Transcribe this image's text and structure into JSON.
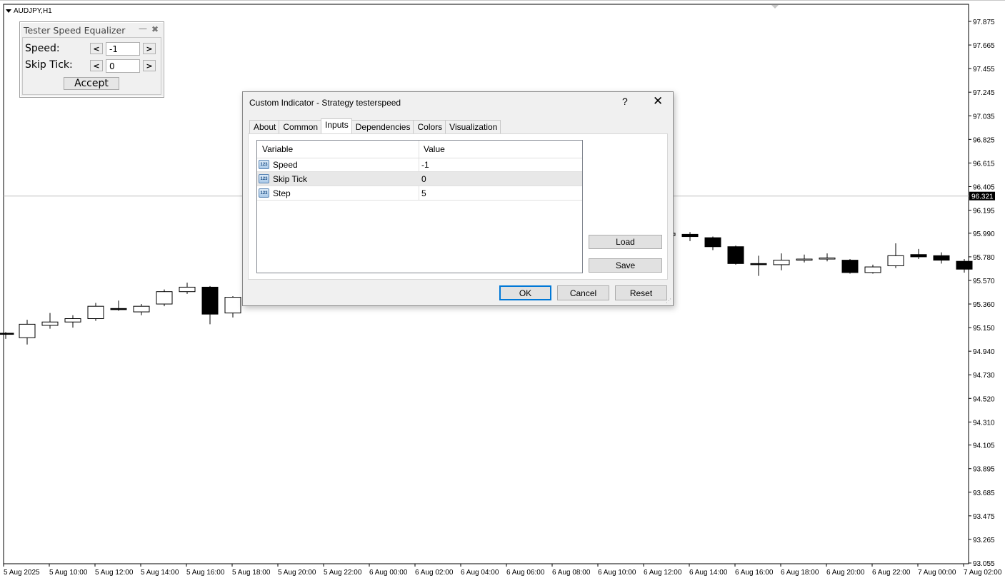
{
  "chart": {
    "symbol": "AUDJPY,H1",
    "y_ticks": [
      "97.875",
      "97.665",
      "97.455",
      "97.245",
      "97.035",
      "96.825",
      "96.615",
      "96.405",
      "96.195",
      "95.990",
      "95.780",
      "95.570",
      "95.360",
      "95.150",
      "94.940",
      "94.730",
      "94.520",
      "94.310",
      "94.105",
      "93.895",
      "93.685",
      "93.475",
      "93.265",
      "93.055"
    ],
    "current_price": "96.321",
    "x_ticks": [
      "5 Aug 2025",
      "5 Aug 10:00",
      "5 Aug 12:00",
      "5 Aug 14:00",
      "5 Aug 16:00",
      "5 Aug 18:00",
      "5 Aug 20:00",
      "5 Aug 22:00",
      "6 Aug 00:00",
      "6 Aug 02:00",
      "6 Aug 04:00",
      "6 Aug 06:00",
      "6 Aug 08:00",
      "6 Aug 10:00",
      "6 Aug 12:00",
      "6 Aug 14:00",
      "6 Aug 16:00",
      "6 Aug 18:00",
      "6 Aug 20:00",
      "6 Aug 22:00",
      "7 Aug 00:00",
      "7 Aug 02:00"
    ]
  },
  "chart_data": {
    "type": "candlestick",
    "ylim": [
      93.055,
      97.875
    ],
    "current_price": 96.321,
    "candles": [
      {
        "t": "5 Aug 08:00",
        "o": 95.1,
        "h": 95.11,
        "l": 95.05,
        "c": 95.09
      },
      {
        "t": "5 Aug 09:00",
        "o": 95.06,
        "h": 95.22,
        "l": 95.0,
        "c": 95.18
      },
      {
        "t": "5 Aug 10:00",
        "o": 95.17,
        "h": 95.28,
        "l": 95.14,
        "c": 95.2
      },
      {
        "t": "5 Aug 10:00",
        "o": 95.2,
        "h": 95.26,
        "l": 95.15,
        "c": 95.23
      },
      {
        "t": "5 Aug 12:00",
        "o": 95.23,
        "h": 95.37,
        "l": 95.21,
        "c": 95.34
      },
      {
        "t": "5 Aug 12:00",
        "o": 95.32,
        "h": 95.39,
        "l": 95.3,
        "c": 95.31
      },
      {
        "t": "5 Aug 14:00",
        "o": 95.29,
        "h": 95.36,
        "l": 95.26,
        "c": 95.34
      },
      {
        "t": "5 Aug 14:00",
        "o": 95.36,
        "h": 95.49,
        "l": 95.34,
        "c": 95.47
      },
      {
        "t": "5 Aug 16:00",
        "o": 95.47,
        "h": 95.55,
        "l": 95.45,
        "c": 95.51
      },
      {
        "t": "5 Aug 16:00",
        "o": 95.51,
        "h": 95.52,
        "l": 95.18,
        "c": 95.27
      },
      {
        "t": "5 Aug 18:00",
        "o": 95.28,
        "h": 95.43,
        "l": 95.24,
        "c": 95.42
      },
      {
        "t": "6 Aug 12:00",
        "o": 95.97,
        "h": 96.0,
        "l": 95.95,
        "c": 95.99
      },
      {
        "t": "6 Aug 13:00",
        "o": 95.98,
        "h": 96.0,
        "l": 95.92,
        "c": 95.96
      },
      {
        "t": "6 Aug 14:00",
        "o": 95.95,
        "h": 95.96,
        "l": 95.84,
        "c": 95.87
      },
      {
        "t": "6 Aug 15:00",
        "o": 95.87,
        "h": 95.88,
        "l": 95.71,
        "c": 95.72
      },
      {
        "t": "6 Aug 16:00",
        "o": 95.72,
        "h": 95.79,
        "l": 95.61,
        "c": 95.71
      },
      {
        "t": "6 Aug 17:00",
        "o": 95.71,
        "h": 95.81,
        "l": 95.66,
        "c": 95.75
      },
      {
        "t": "6 Aug 18:00",
        "o": 95.75,
        "h": 95.8,
        "l": 95.73,
        "c": 95.76
      },
      {
        "t": "6 Aug 19:00",
        "o": 95.76,
        "h": 95.81,
        "l": 95.74,
        "c": 95.77
      },
      {
        "t": "6 Aug 20:00",
        "o": 95.75,
        "h": 95.76,
        "l": 95.63,
        "c": 95.64
      },
      {
        "t": "6 Aug 21:00",
        "o": 95.64,
        "h": 95.71,
        "l": 95.63,
        "c": 95.69
      },
      {
        "t": "6 Aug 22:00",
        "o": 95.7,
        "h": 95.9,
        "l": 95.68,
        "c": 95.79
      },
      {
        "t": "6 Aug 23:00",
        "o": 95.8,
        "h": 95.85,
        "l": 95.76,
        "c": 95.78
      },
      {
        "t": "7 Aug 00:00",
        "o": 95.79,
        "h": 95.82,
        "l": 95.72,
        "c": 95.75
      },
      {
        "t": "7 Aug 01:00",
        "o": 95.74,
        "h": 95.76,
        "l": 95.64,
        "c": 95.67
      }
    ]
  },
  "tester_panel": {
    "title": "Tester Speed Equalizer",
    "min_glyph": "—",
    "close_glyph": "✖",
    "speed_label": "Speed:",
    "speed_value": "-1",
    "skip_label": "Skip Tick:",
    "skip_value": "0",
    "dec_label": "<",
    "inc_label": ">",
    "accept_label": "Accept"
  },
  "dialog": {
    "title": "Custom Indicator - Strategy testerspeed",
    "help": "?",
    "close": "✕",
    "tabs": [
      "About",
      "Common",
      "Inputs",
      "Dependencies",
      "Colors",
      "Visualization"
    ],
    "active_tab": "Inputs",
    "columns": [
      "Variable",
      "Value"
    ],
    "rows": [
      {
        "name": "Speed",
        "value": "-1",
        "icon": "123"
      },
      {
        "name": "Skip Tick",
        "value": "0",
        "icon": "123"
      },
      {
        "name": "Step",
        "value": "5",
        "icon": "123"
      }
    ],
    "load_label": "Load",
    "save_label": "Save",
    "ok_label": "OK",
    "cancel_label": "Cancel",
    "reset_label": "Reset"
  }
}
